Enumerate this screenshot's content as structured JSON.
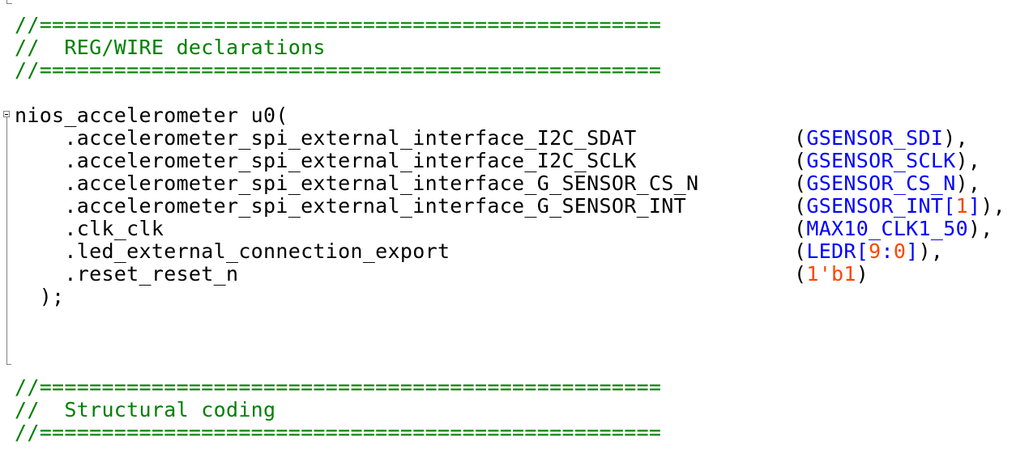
{
  "code": {
    "header1": {
      "rule": "//==================================================",
      "title": "//  REG/WIRE declarations",
      "rule2": "//=================================================="
    },
    "module_open": "nios_accelerometer u0(",
    "ports": [
      {
        "name": "    .accelerometer_spi_external_interface_I2C_SDAT",
        "open": "(",
        "signal": "GSENSOR_SDI",
        "idx_open": "",
        "idx": "",
        "idx_close": "",
        "close": "),"
      },
      {
        "name": "    .accelerometer_spi_external_interface_I2C_SCLK",
        "open": "(",
        "signal": "GSENSOR_SCLK",
        "idx_open": "",
        "idx": "",
        "idx_close": "",
        "close": "),"
      },
      {
        "name": "    .accelerometer_spi_external_interface_G_SENSOR_CS_N",
        "open": "(",
        "signal": "GSENSOR_CS_N",
        "idx_open": "",
        "idx": "",
        "idx_close": "",
        "close": "),"
      },
      {
        "name": "    .accelerometer_spi_external_interface_G_SENSOR_INT",
        "open": "(",
        "signal": "GSENSOR_INT",
        "idx_open": "[",
        "idx": "1",
        "idx_close": "]",
        "close": "),"
      },
      {
        "name": "    .clk_clk",
        "open": "(",
        "signal": "MAX10_CLK1_50",
        "idx_open": "",
        "idx": "",
        "idx_close": "",
        "close": "),"
      },
      {
        "name": "    .led_external_connection_export",
        "open": "(",
        "signal": "LEDR",
        "idx_open": "[",
        "idx": "9",
        "idx_sep": ":",
        "idx2": "0",
        "idx_close": "]",
        "close": "),"
      },
      {
        "name": "    .reset_reset_n",
        "open": "(",
        "signal": "",
        "literal": "1'b1",
        "close": ")"
      }
    ],
    "module_close": "  );",
    "header2": {
      "rule": "//==================================================",
      "title": "//  Structural coding",
      "rule2": "//=================================================="
    }
  },
  "colors": {
    "comment": "#008000",
    "signal": "#0000ff",
    "number": "#ff4500",
    "text": "#000000"
  }
}
